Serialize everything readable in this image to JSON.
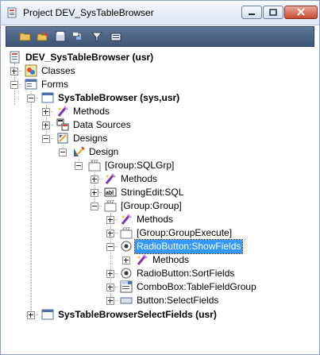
{
  "window": {
    "title": "Project DEV_SysTableBrowser",
    "title_icon": "project-icon"
  },
  "toolbar": {
    "icons": [
      "open-icon",
      "edit-icon",
      "save-icon",
      "compile-icon",
      "filter-icon",
      "properties-icon"
    ]
  },
  "tree": {
    "root": "DEV_SysTableBrowser (usr)",
    "classes": "Classes",
    "forms": "Forms",
    "form1": "SysTableBrowser (sys,usr)",
    "methods1": "Methods",
    "datasources": "Data Sources",
    "designs": "Designs",
    "design": "Design",
    "sqlgrp": "[Group:SQLGrp]",
    "methods2": "Methods",
    "stringedit": "StringEdit:SQL",
    "groupgroup": "[Group:Group]",
    "methods3": "Methods",
    "groupexecute": "[Group:GroupExecute]",
    "radio_showfields": "RadioButton:ShowFields",
    "methods4": "Methods",
    "radio_sortfields": "RadioButton:SortFields",
    "combobox": "ComboBox:TableFieldGroup",
    "button": "Button:SelectFields",
    "form2": "SysTableBrowserSelectFields (usr)"
  },
  "colors": {
    "selection": "#3399ff",
    "toolbar": "#4b6385"
  }
}
